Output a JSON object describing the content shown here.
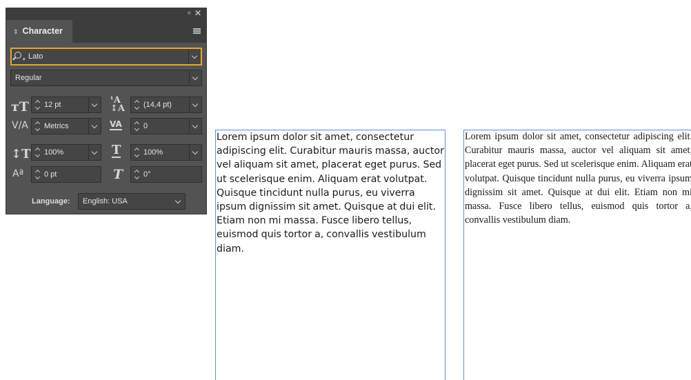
{
  "panel": {
    "title": "Character",
    "collapse_glyph": "«",
    "close_glyph": "✕",
    "font_family": "Lato",
    "font_style": "Regular",
    "font_size": "12 pt",
    "leading": "(14,4 pt)",
    "kerning": "Metrics",
    "tracking": "0",
    "vertical_scale": "100%",
    "horizontal_scale": "100%",
    "baseline_shift": "0 pt",
    "skew": "0°",
    "language_label": "Language:",
    "language": "English: USA",
    "accent_color": "#e6a829",
    "icons": [
      "search-icon",
      "font-size-icon",
      "leading-icon",
      "kerning-icon",
      "tracking-icon",
      "vertical-scale-icon",
      "horizontal-scale-icon",
      "baseline-shift-icon",
      "skew-icon",
      "panel-menu-icon"
    ]
  },
  "frames": {
    "left_text": "Lorem ipsum dolor sit amet, consectetur adipiscing elit. Curabitur mauris massa, auctor vel aliquam sit amet, placerat eget purus. Sed ut scelerisque enim. Aliquam erat volutpat. Quisque tincidunt nulla purus, eu viverra ipsum dignissim sit amet. Quisque at dui elit. Etiam non mi massa. Fusce libero tellus, euismod quis tortor a, convallis vestibulum diam.",
    "right_text": "Lorem ipsum dolor sit amet, consectetur adipiscing elit. Curabitur mauris massa, auctor vel aliquam sit amet, placerat eget purus. Sed ut scelerisque enim. Aliquam erat volutpat. Quisque tincidunt nulla purus, eu viverra ipsum dignissim sit amet. Quisque at dui elit. Etiam non mi massa. Fusce libero tellus, euismod quis tortor a, convallis vestibulum diam.",
    "border_color": "#5a8fd6"
  }
}
